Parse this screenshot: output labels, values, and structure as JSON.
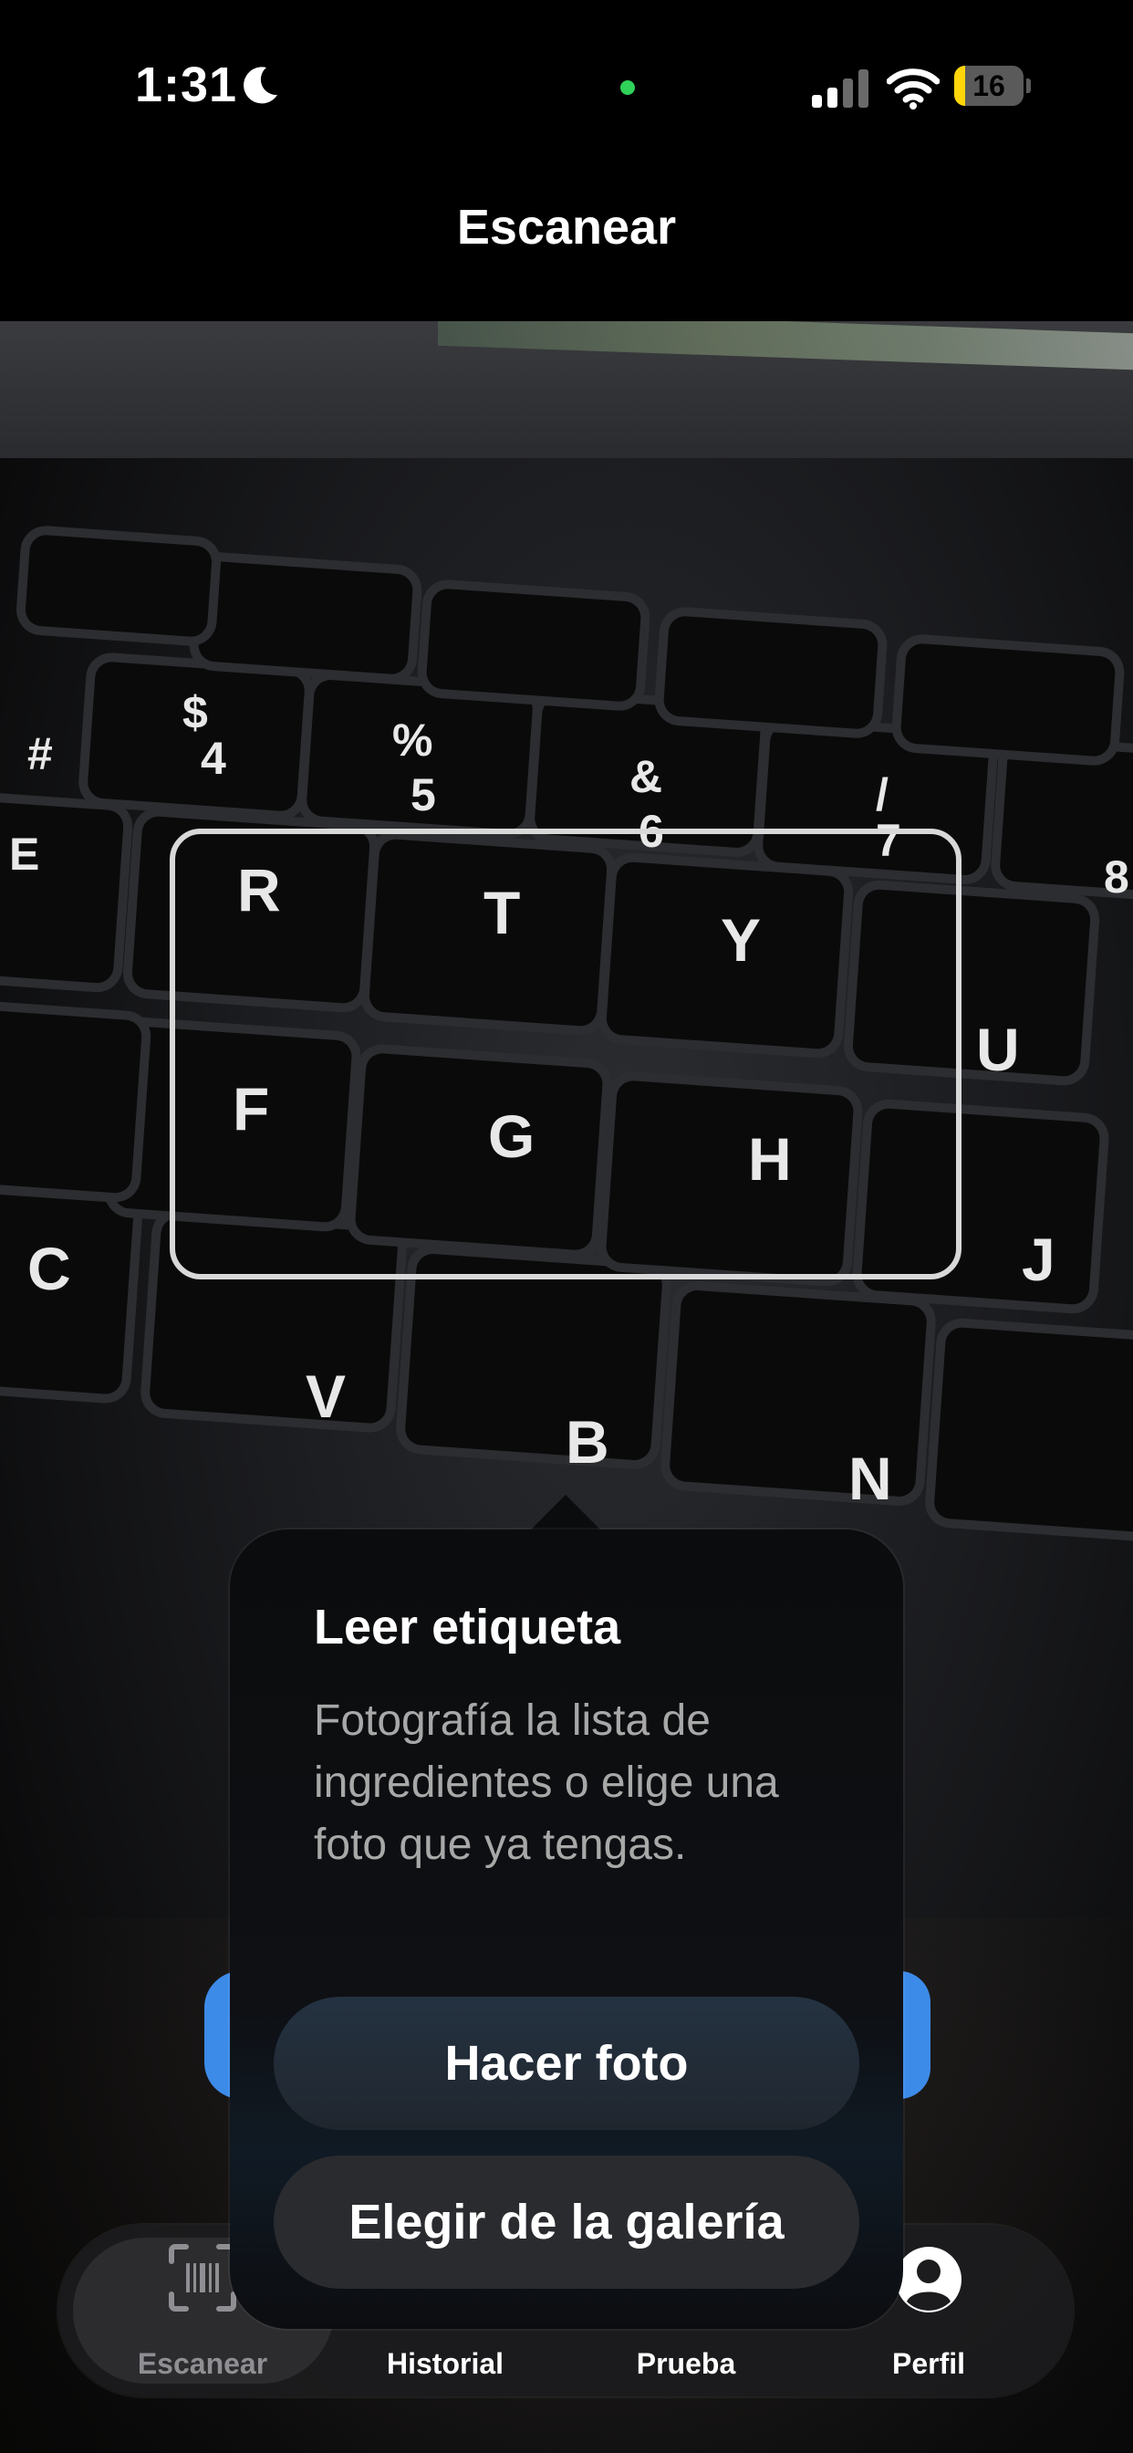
{
  "status_bar": {
    "time": "1:31",
    "battery": "16",
    "battery_level": 0.16
  },
  "header": {
    "title": "Escanear"
  },
  "camera": {
    "key_labels": [
      "$",
      "4",
      "%",
      "5",
      "&",
      "6",
      "/",
      "7",
      "8",
      "#",
      "E",
      "R",
      "T",
      "Y",
      "U",
      "F",
      "G",
      "H",
      "J",
      "C",
      "V",
      "B",
      "N"
    ]
  },
  "popover": {
    "title": "Leer etiqueta",
    "description": "Fotografía la lista de ingredientes o elige una foto que ya tengas.",
    "take_photo": "Hacer foto",
    "choose_gallery": "Elegir de la galería"
  },
  "tabs": [
    {
      "label": "Escanear",
      "icon": "barcode-scan-icon",
      "active": true
    },
    {
      "label": "Historial",
      "icon": "history-icon",
      "active": false
    },
    {
      "label": "Prueba",
      "icon": "test-icon",
      "active": false
    },
    {
      "label": "Perfil",
      "icon": "profile-icon",
      "active": false
    }
  ],
  "colors": {
    "accent": "#3d8be8",
    "battery": "#ffd60a",
    "camera_dot": "#2fd158",
    "active_tab_text": "#8e8e93"
  }
}
